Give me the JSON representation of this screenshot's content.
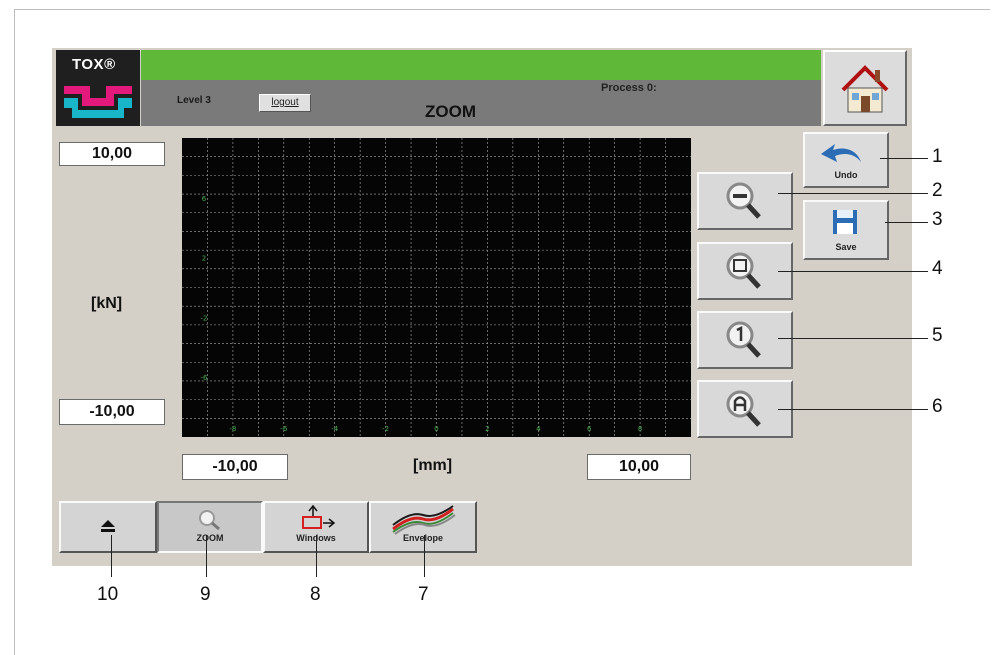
{
  "logo": {
    "text": "TOX®"
  },
  "header": {
    "strip_color": "#5fb838",
    "level": "Level 3",
    "logout_label": "logout",
    "title": "ZOOM",
    "process": "Process 0:"
  },
  "home": {
    "icon": "house-icon"
  },
  "y_axis": {
    "max": "10,00",
    "unit": "[kN]",
    "min": "-10,00"
  },
  "x_axis": {
    "min": "-10,00",
    "unit": "[mm]",
    "max": "10,00"
  },
  "plot": {
    "background": "#050505",
    "grid_color": "#a9a9a9",
    "tick_color": "#4caf50",
    "x_ticks": [
      "-8",
      "-6",
      "-4",
      "-2",
      "0",
      "2",
      "4",
      "6",
      "8"
    ],
    "y_ticks": [
      "6",
      "2",
      "-2",
      "-6"
    ]
  },
  "tools": {
    "undo_label": "Undo",
    "save_label": "Save",
    "zoom_out_icon": "zoom-out-icon",
    "zoom_window_icon": "zoom-window-icon",
    "zoom_1_icon": "zoom-1-icon",
    "zoom_auto_icon": "zoom-auto-icon"
  },
  "tabs": {
    "eject_icon": "eject-icon",
    "zoom_label": "ZOOM",
    "windows_label": "Windows",
    "envelope_label": "Envelope"
  },
  "callouts": {
    "c1": "1",
    "c2": "2",
    "c3": "3",
    "c4": "4",
    "c5": "5",
    "c6": "6",
    "c7": "7",
    "c8": "8",
    "c9": "9",
    "c10": "10"
  }
}
